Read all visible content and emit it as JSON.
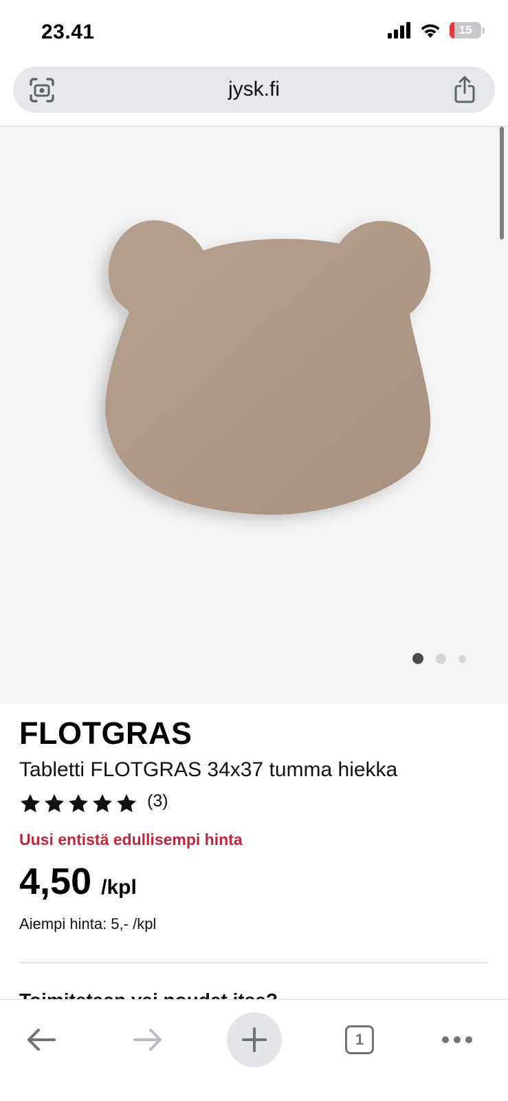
{
  "status_bar": {
    "time": "23.41",
    "battery_level": "15",
    "icons": [
      "cellular-signal-icon",
      "wifi-icon",
      "battery-low-icon"
    ]
  },
  "browser": {
    "url": "jysk.fi",
    "left_icon": "visual-lookup-icon",
    "right_icon": "share-icon"
  },
  "gallery": {
    "image_subject": "bear-shaped-placemat",
    "image_color": "#b09a88",
    "background_color": "#f4f4f4",
    "slide_count": 3,
    "active_slide": 1
  },
  "product": {
    "brand": "FLOTGRAS",
    "subtitle": "Tabletti FLOTGRAS 34x37 tumma hiekka",
    "rating_stars": 5,
    "rating_count": "(3)",
    "promo_text": "Uusi entistä edullisempi hinta",
    "promo_color": "#c0273b",
    "price": "4,50",
    "price_unit": "/kpl",
    "previous_price": "Aiempi hinta: 5,- /kpl",
    "next_section_heading": "Toimitetaan vai noudat itse?"
  },
  "toolbar": {
    "back_icon": "arrow-left-icon",
    "forward_icon": "arrow-right-icon",
    "new_tab_icon": "plus-icon",
    "tab_count": "1",
    "more_icon": "more-horizontal-icon"
  }
}
